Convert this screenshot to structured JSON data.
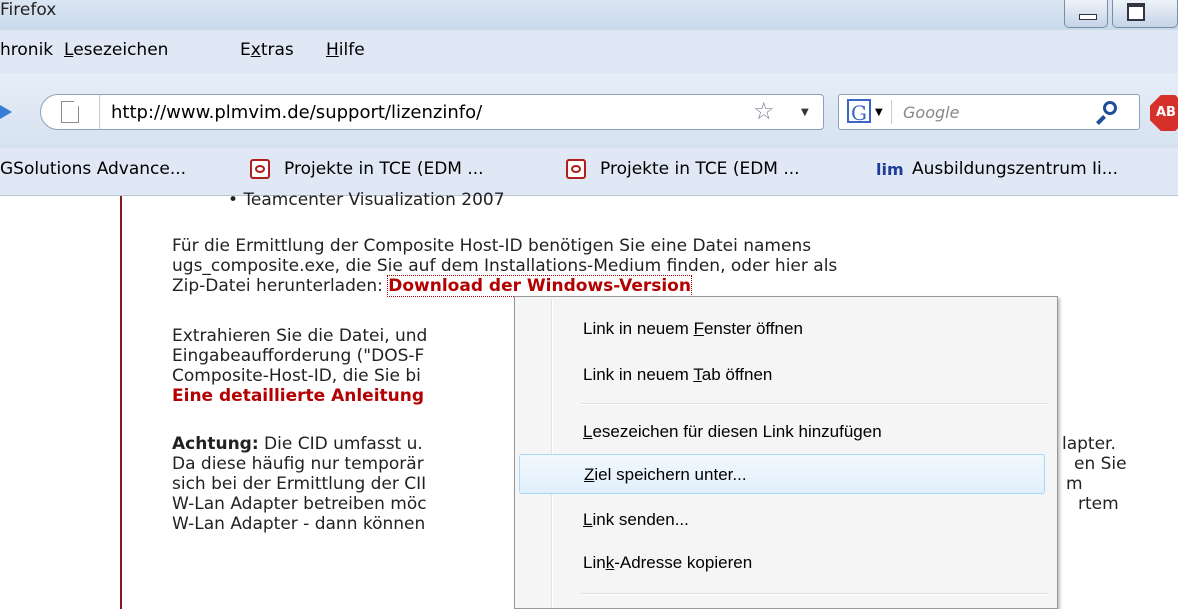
{
  "window": {
    "title": "Firefox"
  },
  "menubar": {
    "items": [
      {
        "pre": "hronik",
        "accel": "",
        "post": ""
      },
      {
        "pre": "",
        "accel": "L",
        "post": "esezeichen"
      },
      {
        "pre": "E",
        "accel": "x",
        "post": "tras"
      },
      {
        "pre": "",
        "accel": "H",
        "post": "ilfe"
      }
    ]
  },
  "navbar": {
    "url": "http://www.plmvim.de/support/lizenzinfo/",
    "search_placeholder": "Google",
    "adblock_label": "AB"
  },
  "bookmarks": [
    {
      "label": "GSolutions Advance..."
    },
    {
      "label": "Projekte in TCE (EDM ..."
    },
    {
      "label": "Projekte in TCE (EDM ..."
    },
    {
      "label": "Ausbildungszentrum Ii..."
    }
  ],
  "bookmark_lim_icon": "lim",
  "content": {
    "bullet": "Teamcenter Visualization 2007",
    "p1_line1": "Für die Ermittlung der Composite Host-ID benötigen Sie eine Datei namens",
    "p1_line2": "ugs_composite.exe, die Sie auf dem Installations-Medium finden, oder hier als",
    "p1_line3_prefix": "Zip-Datei herunterladen: ",
    "p1_link": "Download der Windows-Version",
    "p2_line1": "Extrahieren Sie die Datei, und",
    "p2_line2": "Eingabeaufforderung (\"DOS-F",
    "p2_line3": "Composite-Host-ID, die Sie bi",
    "p2_link": "Eine detaillierte Anleitung",
    "p3_bold": "Achtung:",
    "p3_line1_rest": " Die CID umfasst u.",
    "p3_line2": "Da diese häufig nur temporär",
    "p3_line3": "sich bei der Ermittlung der CII",
    "p3_line4": "W-Lan Adapter betreiben möc",
    "p3_line5": "W-Lan Adapter - dann können",
    "r1": "lapter.",
    "r2": "en Sie",
    "r3": "m",
    "r4": "rtem"
  },
  "context_menu": {
    "items": [
      {
        "pre": "Link in neuem ",
        "accel": "F",
        "post": "enster öffnen"
      },
      {
        "pre": "Link in neuem ",
        "accel": "T",
        "post": "ab öffnen"
      },
      {
        "pre": "",
        "accel": "L",
        "post": "esezeichen für diesen Link hinzufügen"
      },
      {
        "pre": "",
        "accel": "Z",
        "post": "iel speichern unter..."
      },
      {
        "pre": "",
        "accel": "L",
        "post": "ink senden..."
      },
      {
        "pre": "Lin",
        "accel": "k",
        "post": "-Adresse kopieren"
      }
    ],
    "hovered_index": 3
  }
}
